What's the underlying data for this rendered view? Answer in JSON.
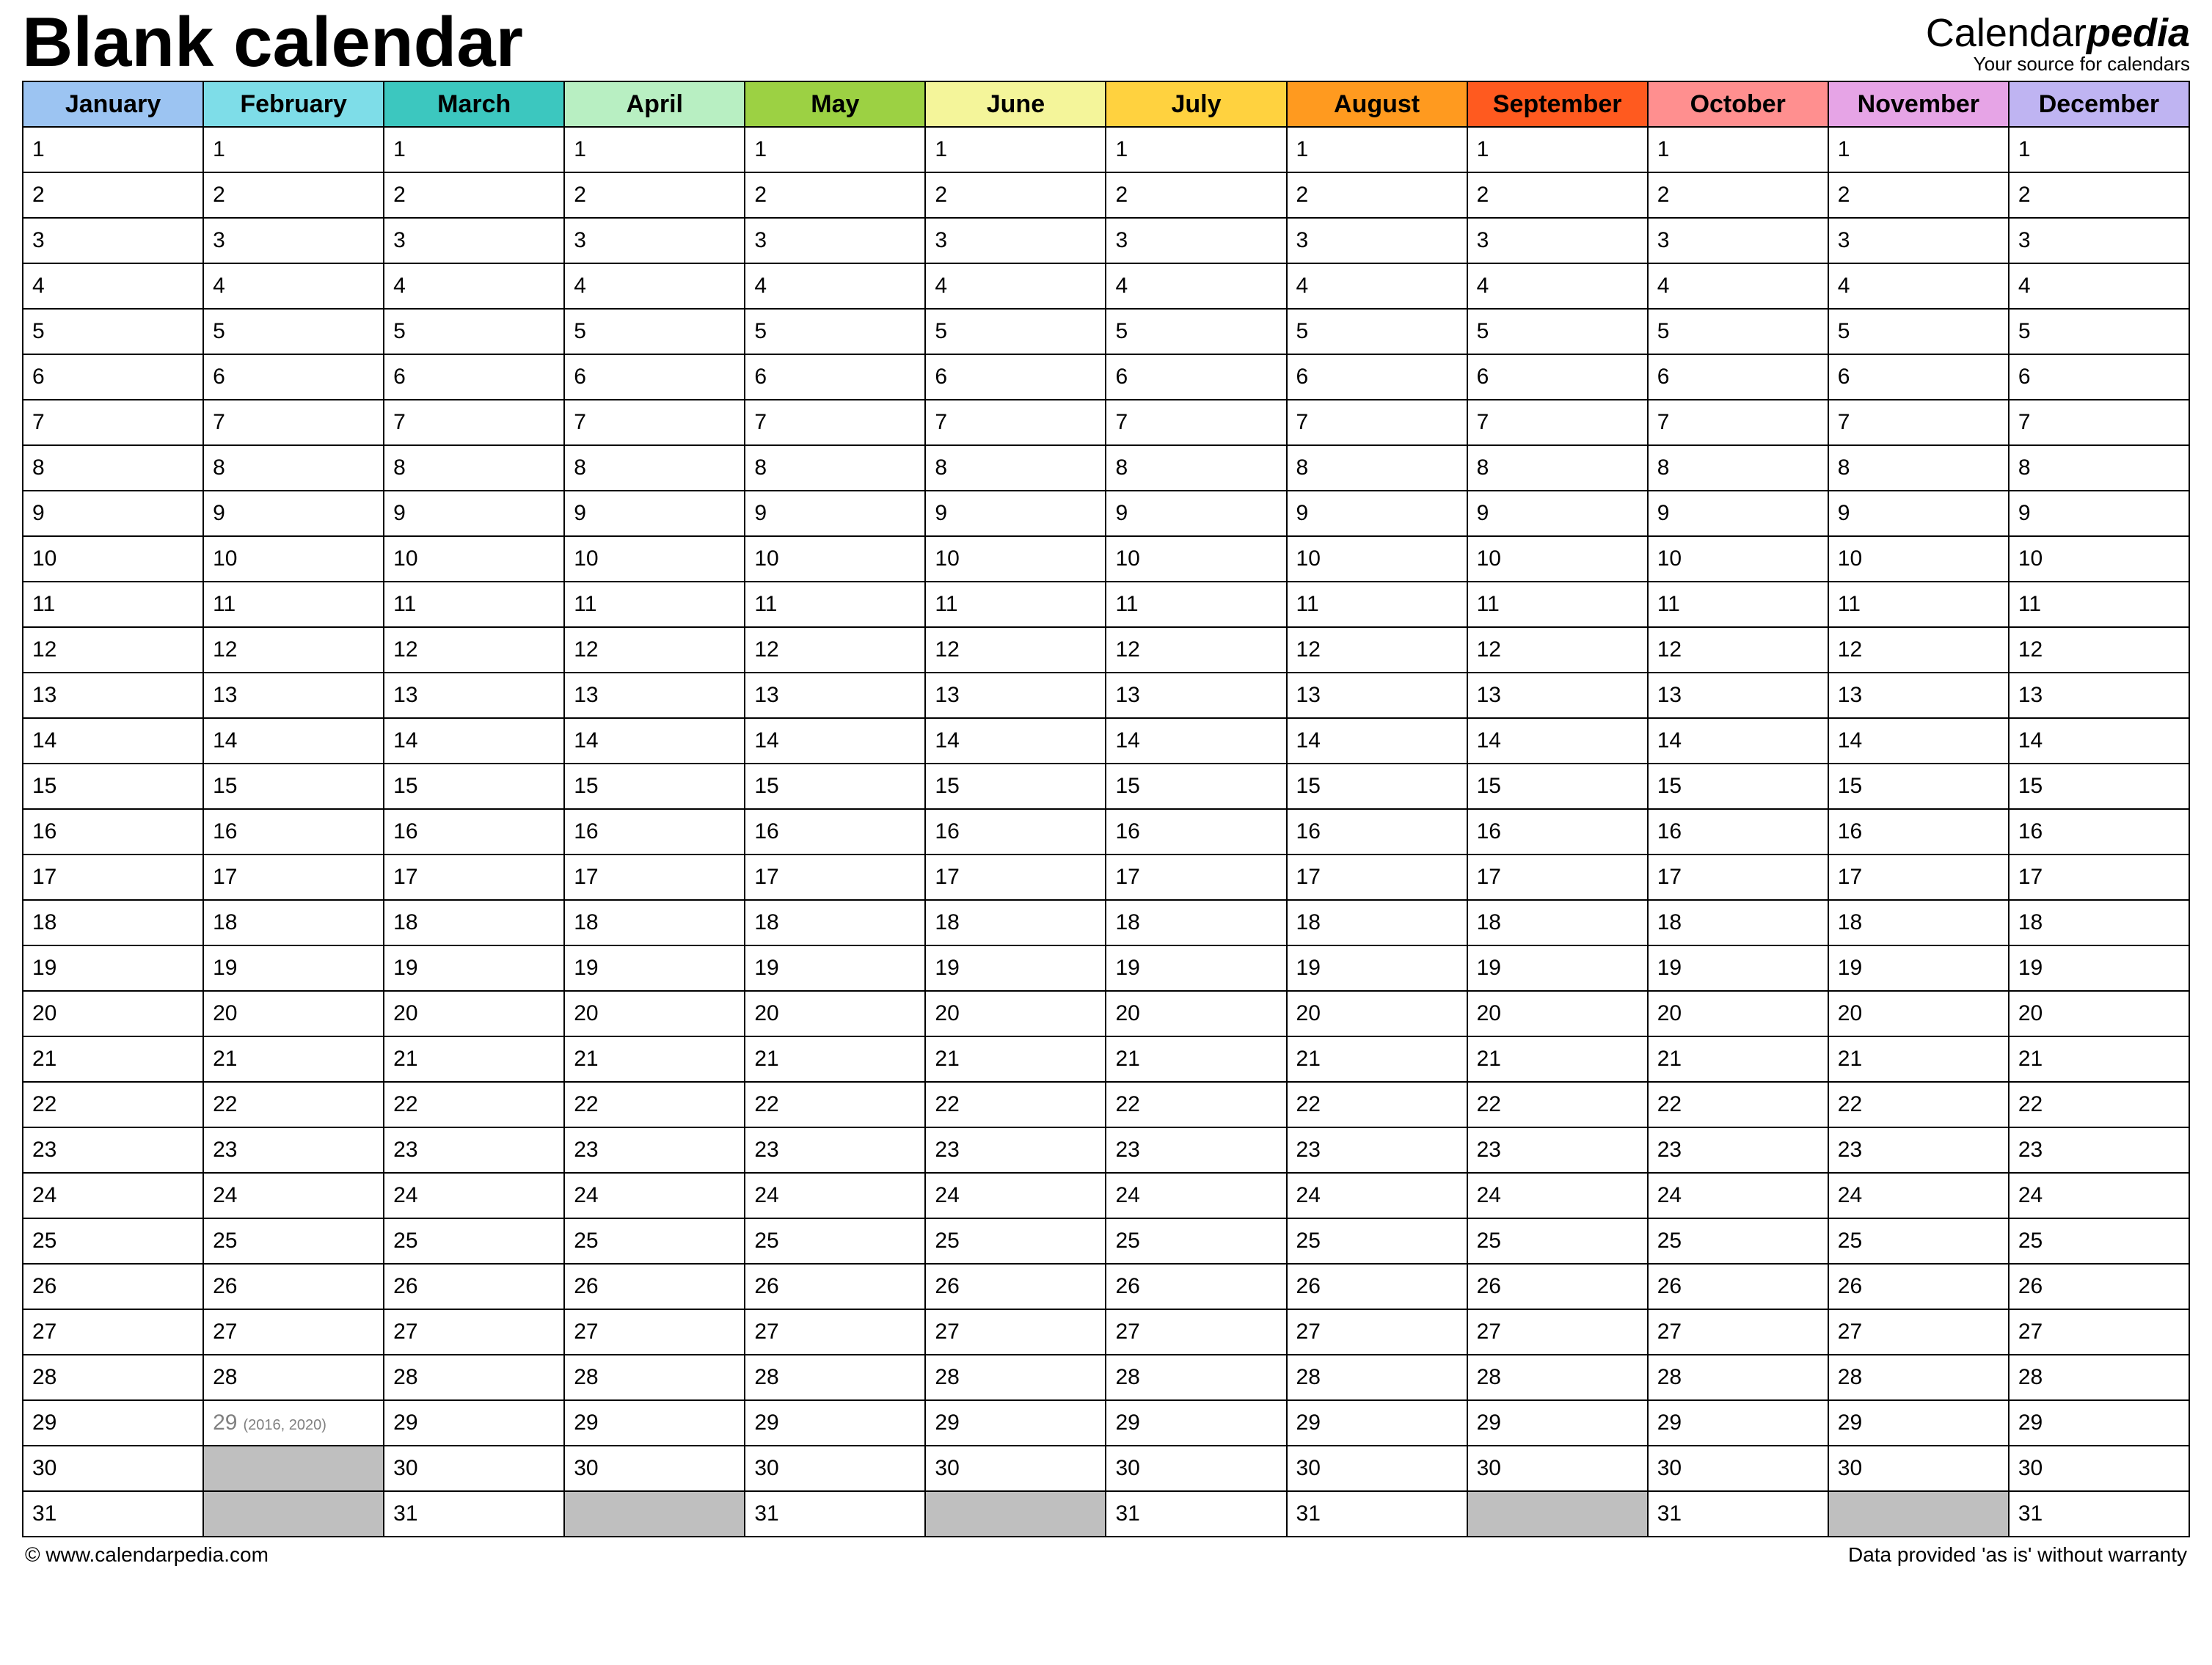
{
  "title": "Blank calendar",
  "brand": {
    "part1": "Calendar",
    "part2": "pedia",
    "tagline": "Your source for calendars"
  },
  "months": [
    {
      "name": "January",
      "bg": "#9cc4f2",
      "days": 31
    },
    {
      "name": "February",
      "bg": "#7edde8",
      "days": 29,
      "special_day": {
        "day": 29,
        "gray": true,
        "note": "(2016, 2020)"
      }
    },
    {
      "name": "March",
      "bg": "#3cc7bf",
      "days": 31
    },
    {
      "name": "April",
      "bg": "#b8efc2",
      "days": 30
    },
    {
      "name": "May",
      "bg": "#9cd143",
      "days": 31
    },
    {
      "name": "June",
      "bg": "#f4f59a",
      "days": 30
    },
    {
      "name": "July",
      "bg": "#ffd23f",
      "days": 31
    },
    {
      "name": "August",
      "bg": "#ff9a1f",
      "days": 31
    },
    {
      "name": "September",
      "bg": "#ff5a1f",
      "days": 30
    },
    {
      "name": "October",
      "bg": "#ff8f8f",
      "days": 31
    },
    {
      "name": "November",
      "bg": "#e6a4e6",
      "days": 30
    },
    {
      "name": "December",
      "bg": "#bfb4f2",
      "days": 31
    }
  ],
  "max_rows": 31,
  "footer": {
    "left": "© www.calendarpedia.com",
    "right": "Data provided 'as is' without warranty"
  }
}
